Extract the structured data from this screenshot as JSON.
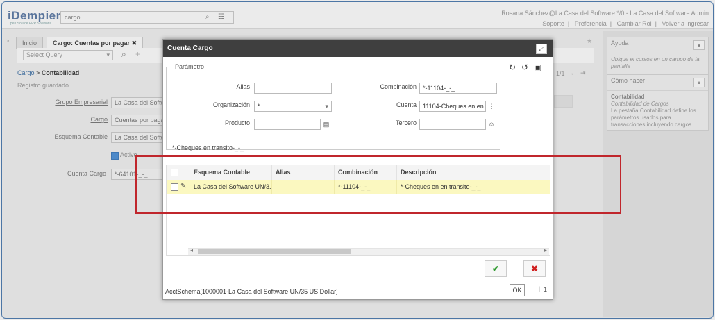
{
  "header": {
    "logo": "iDempiere",
    "logo_sub": "Open Source ERP Solutions",
    "search_value": "cargo",
    "user": "Rosana Sánchez@La Casa del Software.*/0.- La Casa del Software Admin",
    "links": [
      "Soporte",
      "Preferencia",
      "Cambiar Rol",
      "Volver a ingresar"
    ]
  },
  "tabs": [
    {
      "label": "Inicio"
    },
    {
      "label": "Cargo: Cuentas por pagar"
    }
  ],
  "toolbar": {
    "select_query": "Select Query"
  },
  "breadcrumb": {
    "link": "Cargo",
    "sep": ">",
    "current": "Contabilidad"
  },
  "status_msg": "Registro guardado",
  "form": {
    "grupo_label": "Grupo Empresarial",
    "grupo_value": "La Casa del Softwa",
    "cargo_label": "Cargo",
    "cargo_value": "Cuentas por pagar",
    "esquema_label": "Esquema Contable",
    "esquema_value": "La Casa del Softwa",
    "activo_label": "Activo",
    "cuenta_label": "Cuenta Cargo",
    "cuenta_value": "*-64101-_-_"
  },
  "paging": {
    "text": "1/1"
  },
  "right_panel": {
    "ayuda_title": "Ayuda",
    "ayuda_body": "Ubique el cursos en un campo de la pantalla",
    "como_title": "Cómo hacer",
    "como_heading": "Contabilidad",
    "como_sub": "Contabilidad de Cargos",
    "como_body": "La pestaña Contabilidad define los parámetros usados para transacciones incluyendo cargos."
  },
  "dialog": {
    "title": "Cuenta Cargo",
    "param_legend": "Parámetro",
    "alias_label": "Alias",
    "alias_value": "",
    "combinacion_label": "Combinación",
    "combinacion_value": "*-11104-_-_",
    "org_label": "Organización",
    "org_value": "*",
    "cuenta_label": "Cuenta",
    "cuenta_value": "11104-Cheques en en",
    "producto_label": "Producto",
    "producto_value": "",
    "tercero_label": "Tercero",
    "tercero_value": "",
    "combination_text": "*-Cheques en transito-_-_",
    "columns": [
      "Esquema Contable",
      "Alias",
      "Combinación",
      "Descripción"
    ],
    "rows": [
      {
        "esquema": "La Casa del Software UN/3...",
        "alias": "",
        "combinacion": "*-11104-_-_",
        "descripcion": "*-Cheques en en transito-_-_"
      }
    ],
    "status_text": "AcctSchema[1000001-La Casa del Software UN/35 US Dollar]",
    "ok_label": "OK",
    "status_num": "1"
  },
  "colors": {
    "accent": "#4a7ab0",
    "highlight": "#c0262c",
    "row_bg": "#fbf8c0",
    "title_bg": "#3f3f3f"
  },
  "icons": [
    "search-icon",
    "tree-icon",
    "maximize-icon",
    "refresh-icon",
    "undo-icon",
    "save-icon",
    "camera-icon",
    "person-icon",
    "check-icon",
    "close-icon",
    "edit-icon"
  ]
}
